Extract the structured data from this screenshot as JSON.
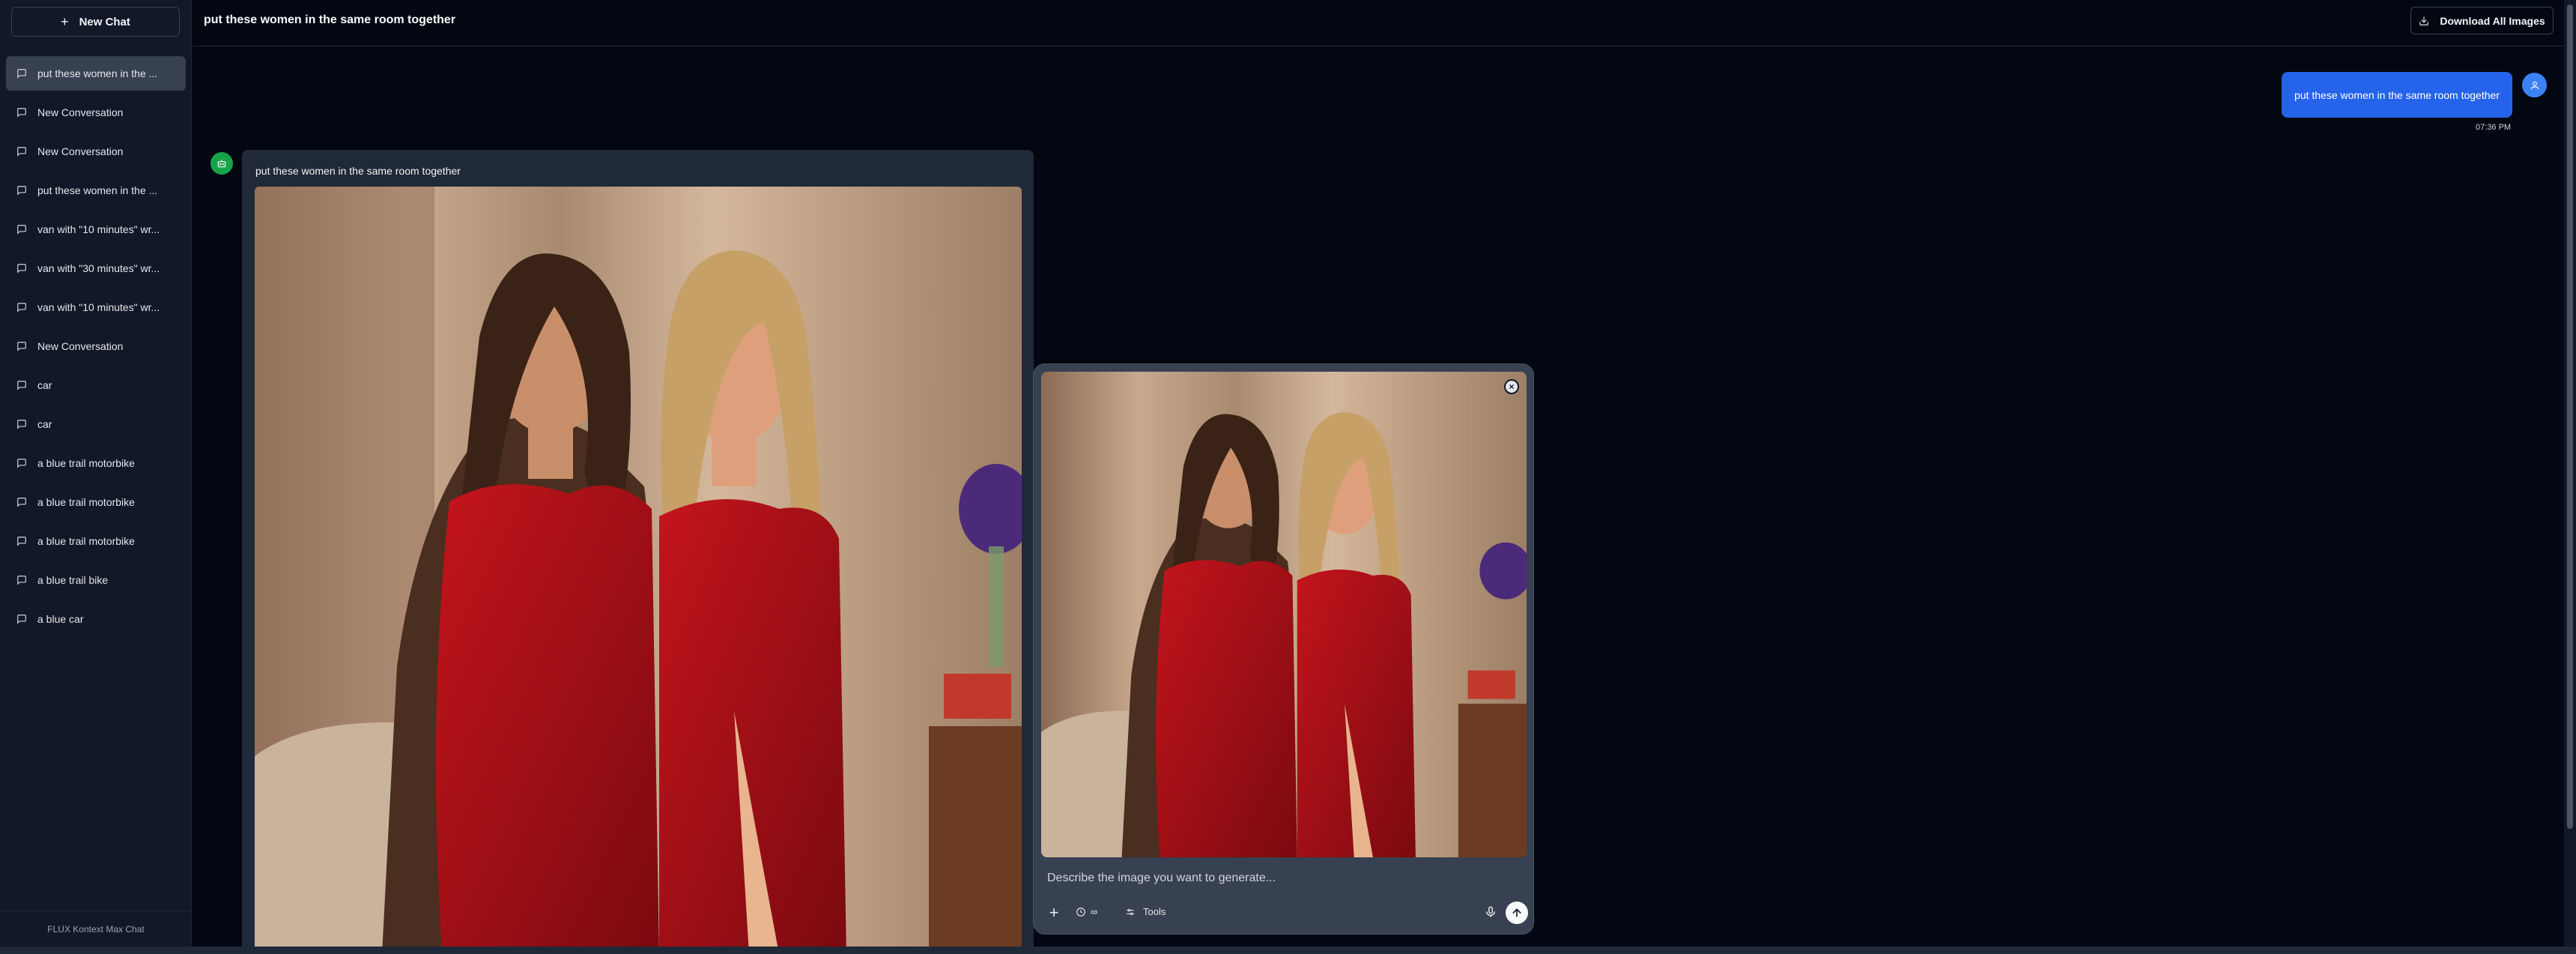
{
  "sidebar": {
    "new_chat_label": "New Chat",
    "conversations": [
      {
        "label": "put these women in the ...",
        "active": true
      },
      {
        "label": "New Conversation"
      },
      {
        "label": "New Conversation"
      },
      {
        "label": "put these women in the ..."
      },
      {
        "label": "van with \"10 minutes\" wr..."
      },
      {
        "label": "van with \"30 minutes\" wr..."
      },
      {
        "label": "van with \"10 minutes\" wr..."
      },
      {
        "label": "New Conversation"
      },
      {
        "label": "car"
      },
      {
        "label": "car"
      },
      {
        "label": "a blue trail motorbike"
      },
      {
        "label": "a blue trail motorbike"
      },
      {
        "label": "a blue trail motorbike"
      },
      {
        "label": "a blue trail bike"
      },
      {
        "label": "a blue car"
      }
    ],
    "footer": "FLUX Kontext Max Chat"
  },
  "header": {
    "title": "put these women in the same room together",
    "download_label": "Download All Images"
  },
  "chat": {
    "user_message": "put these women in the same room together",
    "user_time": "07:36 PM",
    "bot_prompt": "put these women in the same room together"
  },
  "composer": {
    "placeholder": "Describe the image you want to generate...",
    "timer_label": "∞",
    "tools_label": "Tools"
  },
  "colors": {
    "background": "#030712",
    "sidebar": "#111827",
    "accent_blue": "#2563eb",
    "bot_green": "#16a34a"
  }
}
